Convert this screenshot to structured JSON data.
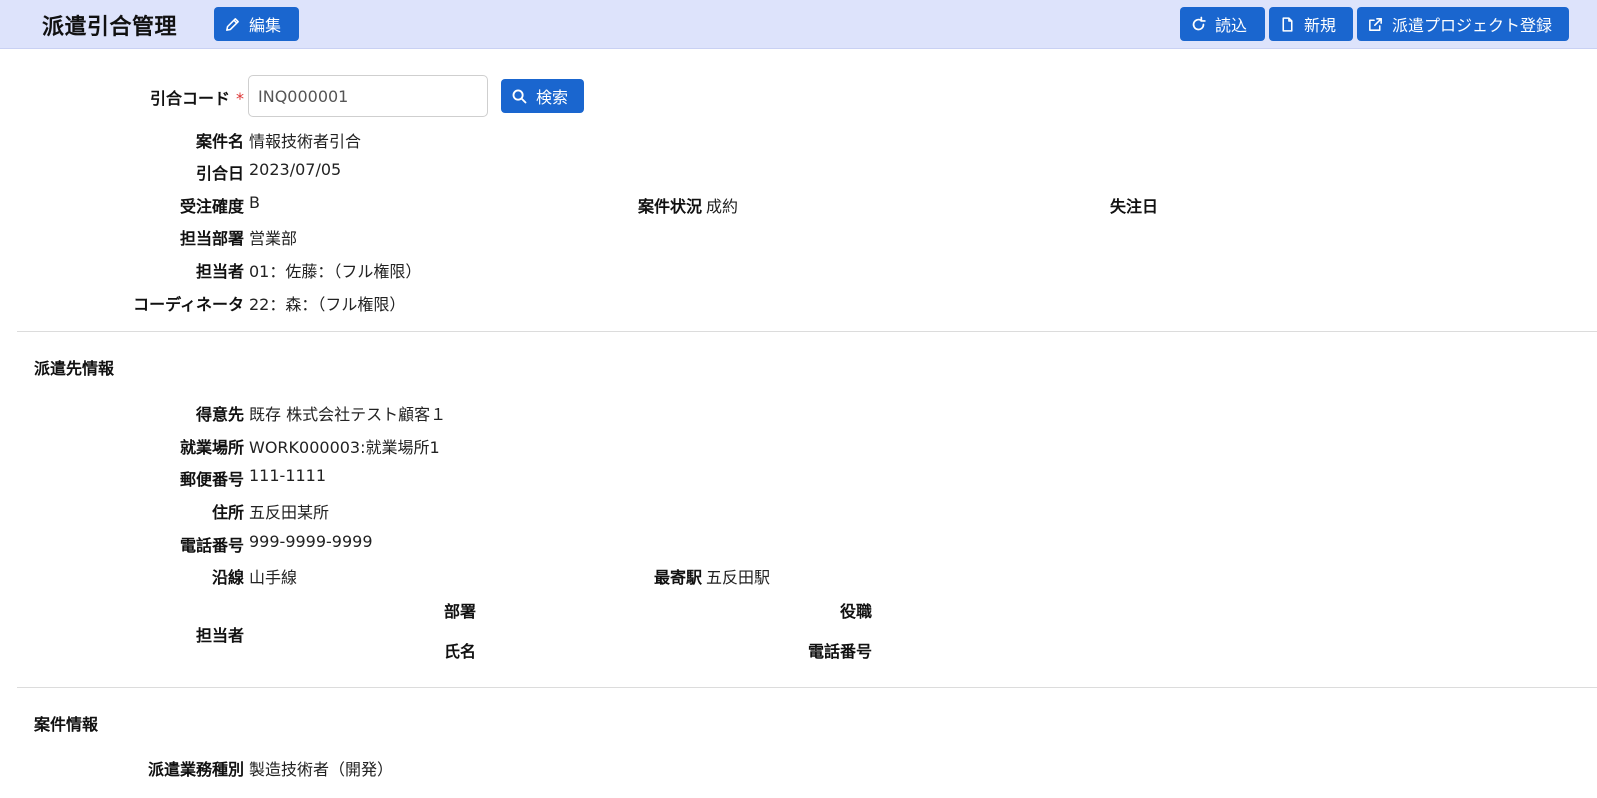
{
  "header": {
    "title": "派遣引合管理",
    "edit_label": "編集",
    "load_label": "読込",
    "new_label": "新規",
    "register_label": "派遣プロジェクト登録"
  },
  "search": {
    "code_label": "引合コード",
    "required_mark": "*",
    "code_value": "INQ000001",
    "search_label": "検索"
  },
  "inquiry": {
    "case_name_label": "案件名",
    "case_name": "情報技術者引合",
    "date_label": "引合日",
    "date": "2023/07/05",
    "certainty_label": "受注確度",
    "certainty": "B",
    "status_label": "案件状況",
    "status": "成約",
    "lost_date_label": "失注日",
    "department_label": "担当部署",
    "department": "営業部",
    "person_label": "担当者",
    "person": "01：佐藤：（フル権限）",
    "coordinator_label": "コーディネータ",
    "coordinator": "22：森：（フル権限）"
  },
  "dispatch_section": {
    "title": "派遣先情報",
    "client_label": "得意先",
    "client": "既存 株式会社テスト顧客１",
    "workplace_label": "就業場所",
    "workplace": "WORK000003:就業場所1",
    "postal_label": "郵便番号",
    "postal": "111-1111",
    "address_label": "住所",
    "address": "五反田某所",
    "phone_label": "電話番号",
    "phone": "999-9999-9999",
    "line_label": "沿線",
    "line": "山手線",
    "station_label": "最寄駅",
    "station": "五反田駅",
    "contact_label": "担当者",
    "contact_dept_label": "部署",
    "contact_title_label": "役職",
    "contact_name_label": "氏名",
    "contact_phone_label": "電話番号"
  },
  "case_section": {
    "title": "案件情報",
    "job_type_label": "派遣業務種別",
    "job_type": "製造技術者（開発）"
  }
}
